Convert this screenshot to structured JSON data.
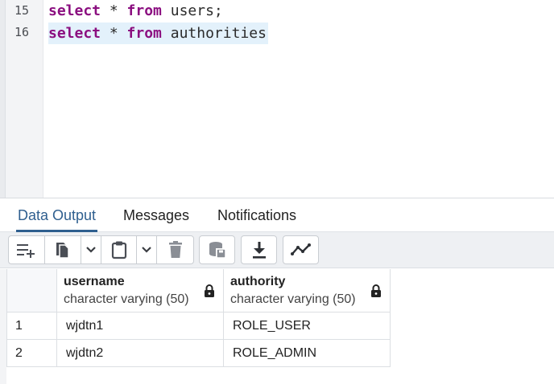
{
  "editor": {
    "lines": [
      {
        "number": "15",
        "keyword1": "select",
        "op": " * ",
        "keyword2": "from",
        "rest": " users;"
      },
      {
        "number": "16",
        "keyword1": "select",
        "op": " * ",
        "keyword2": "from",
        "rest": " authorities"
      }
    ]
  },
  "tabs": [
    {
      "label": "Data Output",
      "active": true
    },
    {
      "label": "Messages",
      "active": false
    },
    {
      "label": "Notifications",
      "active": false
    }
  ],
  "toolbar": {
    "buttons": [
      "add-row-icon",
      "copy-icon",
      "chevron-down-icon",
      "paste-icon",
      "chevron-down-icon",
      "delete-icon",
      "save-data-icon",
      "download-icon",
      "graph-icon"
    ]
  },
  "grid": {
    "columns": [
      {
        "name": "username",
        "type": "character varying (50)"
      },
      {
        "name": "authority",
        "type": "character varying (50)"
      }
    ],
    "rows": [
      {
        "num": "1",
        "cells": [
          "wjdtn1",
          "ROLE_USER"
        ]
      },
      {
        "num": "2",
        "cells": [
          "wjdtn2",
          "ROLE_ADMIN"
        ]
      }
    ]
  },
  "colors": {
    "keyword": "#8b0f80",
    "active_tab": "#2f5f8f",
    "selection": "#e3f1fb"
  }
}
